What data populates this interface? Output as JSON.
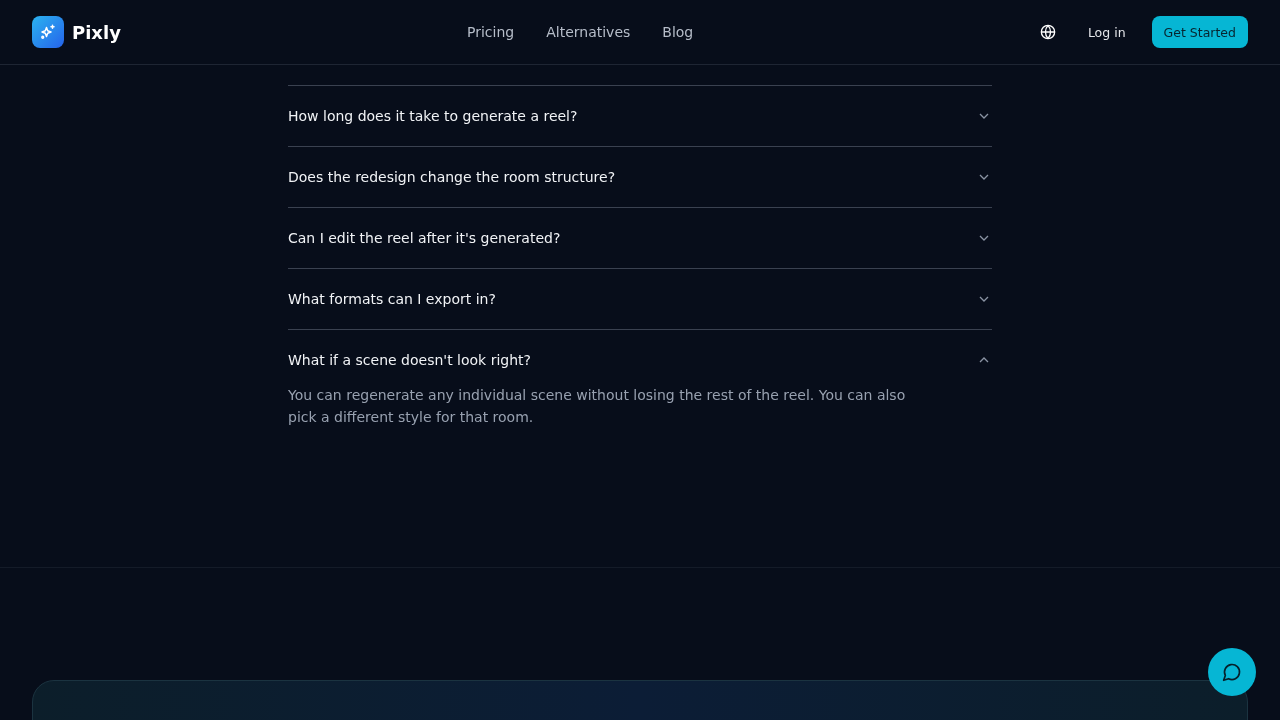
{
  "header": {
    "brand": "Pixly",
    "nav": [
      {
        "label": "Pricing"
      },
      {
        "label": "Alternatives"
      },
      {
        "label": "Blog"
      }
    ],
    "login": "Log in",
    "cta": "Get Started"
  },
  "faq": [
    {
      "question": "How long does it take to generate a reel?",
      "expanded": false
    },
    {
      "question": "Does the redesign change the room structure?",
      "expanded": false
    },
    {
      "question": "Can I edit the reel after it's generated?",
      "expanded": false
    },
    {
      "question": "What formats can I export in?",
      "expanded": false
    },
    {
      "question": "What if a scene doesn't look right?",
      "expanded": true,
      "answer": "You can regenerate any individual scene without losing the rest of the reel. You can also pick a different style for that room."
    }
  ]
}
